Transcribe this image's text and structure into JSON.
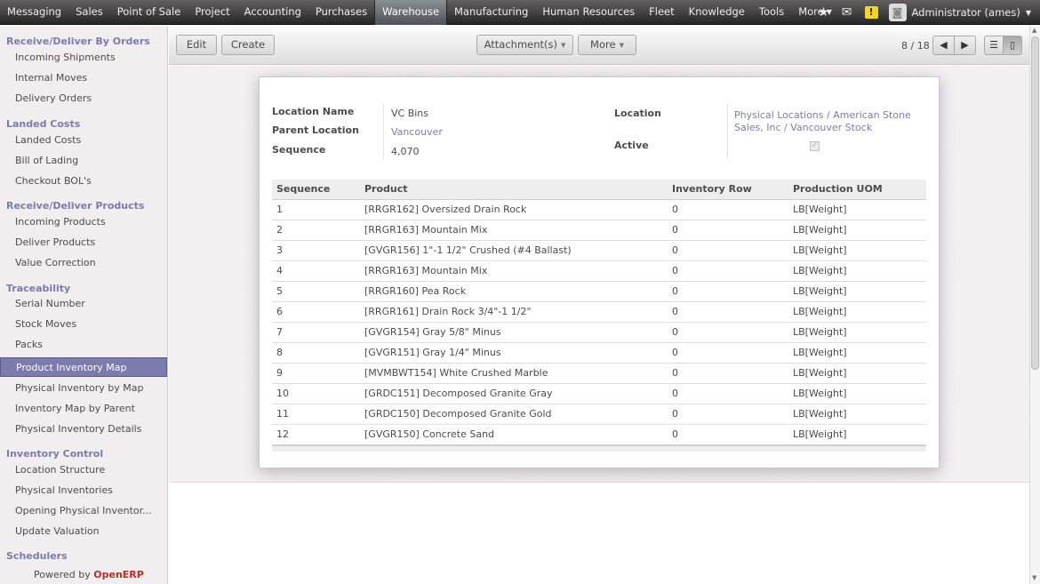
{
  "topmenu": {
    "items": [
      "Messaging",
      "Sales",
      "Point of Sale",
      "Project",
      "Accounting",
      "Purchases",
      "Warehouse",
      "Manufacturing",
      "Human Resources",
      "Fleet",
      "Knowledge",
      "Tools",
      "More"
    ],
    "active": "Warehouse",
    "more_caret": "▼",
    "icons": {
      "star": "★",
      "mail": "✉",
      "alert": "!",
      "avatar": "◙"
    },
    "user": "Administrator (ames)",
    "user_caret": "▼"
  },
  "sidebar": {
    "sections": [
      {
        "title": "Receive/Deliver By Orders",
        "items": [
          "Incoming Shipments",
          "Internal Moves",
          "Delivery Orders"
        ]
      },
      {
        "title": "Landed Costs",
        "items": [
          "Landed Costs",
          "Bill of Lading",
          "Checkout BOL's"
        ]
      },
      {
        "title": "Receive/Deliver Products",
        "items": [
          "Incoming Products",
          "Deliver Products",
          "Value Correction"
        ]
      },
      {
        "title": "Traceability",
        "items": [
          "Serial Number",
          "Stock Moves",
          "Packs",
          "Product Inventory Map",
          "Physical Inventory by Map",
          "Inventory Map by Parent",
          "Physical Inventory Details"
        ]
      },
      {
        "title": "Inventory Control",
        "items": [
          "Location Structure",
          "Physical Inventories",
          "Opening Physical Inventor...",
          "Update Valuation"
        ]
      },
      {
        "title": "Schedulers",
        "items": []
      }
    ],
    "active_item": "Product Inventory Map",
    "powered_by": "Powered by",
    "brand": "OpenERP"
  },
  "toolbar": {
    "edit": "Edit",
    "create": "Create",
    "attachments": "Attachment(s)",
    "more": "More",
    "dropdown_caret": "▼",
    "pager": "8 / 18",
    "prev_icon": "◀",
    "next_icon": "▶",
    "list_icon": "☰",
    "form_icon": "▯"
  },
  "form": {
    "location_name_label": "Location Name",
    "location_name": "VC Bins",
    "parent_location_label": "Parent Location",
    "parent_location": "Vancouver",
    "sequence_label": "Sequence",
    "sequence": "4,070",
    "location_label": "Location",
    "location_line1": "Physical Locations / American Stone",
    "location_line2": "Sales, Inc / Vancouver Stock",
    "active_label": "Active",
    "active_check": "✓",
    "table": {
      "headers": [
        "Sequence",
        "Product",
        "Inventory Row",
        "Production UOM"
      ],
      "rows": [
        [
          "1",
          "[RRGR162] Oversized Drain Rock",
          "0",
          "LB[Weight]"
        ],
        [
          "2",
          "[RRGR163] Mountain Mix",
          "0",
          "LB[Weight]"
        ],
        [
          "3",
          "[GVGR156] 1\"-1 1/2\" Crushed (#4 Ballast)",
          "0",
          "LB[Weight]"
        ],
        [
          "4",
          "[RRGR163] Mountain Mix",
          "0",
          "LB[Weight]"
        ],
        [
          "5",
          "[RRGR160] Pea Rock",
          "0",
          "LB[Weight]"
        ],
        [
          "6",
          "[RRGR161] Drain Rock 3/4\"-1 1/2\"",
          "0",
          "LB[Weight]"
        ],
        [
          "7",
          "[GVGR154] Gray 5/8\" Minus",
          "0",
          "LB[Weight]"
        ],
        [
          "8",
          "[GVGR151] Gray 1/4\" Minus",
          "0",
          "LB[Weight]"
        ],
        [
          "9",
          "[MVMBWT154] White Crushed Marble",
          "0",
          "LB[Weight]"
        ],
        [
          "10",
          "[GRDC151] Decomposed Granite Gray",
          "0",
          "LB[Weight]"
        ],
        [
          "11",
          "[GRDC150] Decomposed Granite Gold",
          "0",
          "LB[Weight]"
        ],
        [
          "12",
          "[GVGR150] Concrete Sand",
          "0",
          "LB[Weight]"
        ]
      ]
    }
  },
  "scrollbar": {
    "up_arrow": "▲",
    "down_arrow": "▼"
  },
  "colors": {
    "accent": "#7c7bad",
    "brand": "#b92c28",
    "topbar": "#262626"
  }
}
